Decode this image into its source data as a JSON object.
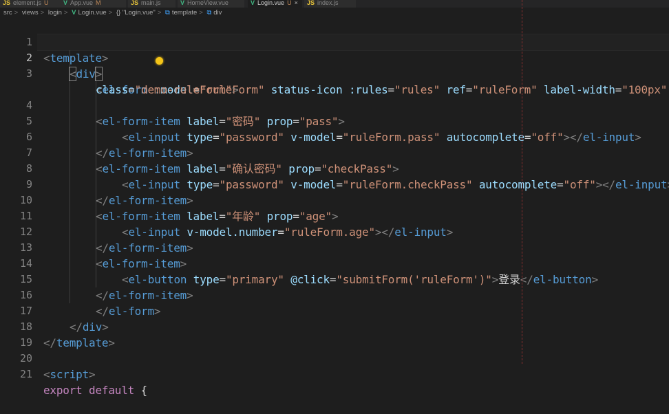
{
  "tabs": [
    {
      "label": "element.js",
      "suffix": "U",
      "icon": "JS",
      "type": "js",
      "active": false
    },
    {
      "label": "App.vue",
      "suffix": "M",
      "icon": "V",
      "type": "vue",
      "active": false
    },
    {
      "label": "main.js",
      "suffix": "",
      "icon": "JS",
      "type": "js",
      "active": false
    },
    {
      "label": "HomeView.vue",
      "suffix": "",
      "icon": "V",
      "type": "vue",
      "active": false
    },
    {
      "label": "Login.vue",
      "suffix": "U",
      "icon": "V",
      "type": "vue",
      "active": true,
      "close": "×"
    },
    {
      "label": "index.js",
      "suffix": "",
      "icon": "JS",
      "type": "js",
      "active": false
    }
  ],
  "breadcrumb": {
    "items": [
      "src",
      "views",
      "login"
    ],
    "file": "Login.vue",
    "obj": "{} \"Login.vue\"",
    "template": "template",
    "div": "div",
    "separator": ">"
  },
  "line_numbers": [
    "1",
    "2",
    "3",
    "4",
    "5",
    "6",
    "7",
    "8",
    "9",
    "10",
    "11",
    "12",
    "13",
    "14",
    "15",
    "16",
    "17",
    "18",
    "19",
    "20",
    "21"
  ],
  "code": {
    "l1": [
      "<",
      "template",
      ">"
    ],
    "l2": [
      "<",
      "div",
      ">"
    ],
    "l3": [
      "<",
      "el-form",
      ":model",
      "=",
      "\"ruleForm\"",
      "status-icon",
      ":rules",
      "=",
      "\"rules\"",
      "ref",
      "=",
      "\"ruleForm\"",
      "label-width",
      "=",
      "\"100px\""
    ],
    "l3b": [
      "class",
      "=",
      "\"demo-ruleForm\"",
      ">"
    ],
    "l4": [
      "<",
      "el-form-item",
      "label",
      "=",
      "\"密码\"",
      "prop",
      "=",
      "\"pass\"",
      ">"
    ],
    "l5": [
      "<",
      "el-input",
      "type",
      "=",
      "\"password\"",
      "v-model",
      "=",
      "\"ruleForm.pass\"",
      "autocomplete",
      "=",
      "\"off\"",
      "></",
      "el-input",
      ">"
    ],
    "l6": [
      "</",
      "el-form-item",
      ">"
    ],
    "l7": [
      "<",
      "el-form-item",
      "label",
      "=",
      "\"确认密码\"",
      "prop",
      "=",
      "\"checkPass\"",
      ">"
    ],
    "l8": [
      "<",
      "el-input",
      "type",
      "=",
      "\"password\"",
      "v-model",
      "=",
      "\"ruleForm.checkPass\"",
      "autocomplete",
      "=",
      "\"off\"",
      "></",
      "el-input",
      ">"
    ],
    "l9": [
      "</",
      "el-form-item",
      ">"
    ],
    "l10": [
      "<",
      "el-form-item",
      "label",
      "=",
      "\"年龄\"",
      "prop",
      "=",
      "\"age\"",
      ">"
    ],
    "l11": [
      "<",
      "el-input",
      "v-model.number",
      "=",
      "\"ruleForm.age\"",
      "></",
      "el-input",
      ">"
    ],
    "l12": [
      "</",
      "el-form-item",
      ">"
    ],
    "l13": [
      "<",
      "el-form-item",
      ">"
    ],
    "l14": [
      "<",
      "el-button",
      "type",
      "=",
      "\"primary\"",
      "@click",
      "=",
      "\"submitForm('ruleForm')\"",
      ">",
      "登录",
      "</",
      "el-button",
      ">"
    ],
    "l15": [
      "</",
      "el-form-item",
      ">"
    ],
    "l16": [
      "</",
      "el-form",
      ">"
    ],
    "l17": [
      "</",
      "div",
      ">"
    ],
    "l18": [
      "</",
      "template",
      ">"
    ],
    "l20": [
      "<",
      "script",
      ">"
    ],
    "l21": [
      "export",
      "default",
      "{"
    ]
  },
  "colors": {
    "background": "#1e1e1e",
    "punctuation": "#808080",
    "tag": "#569cd6",
    "attribute": "#9cdcfe",
    "string": "#ce9178",
    "keyword": "#c586c0"
  }
}
